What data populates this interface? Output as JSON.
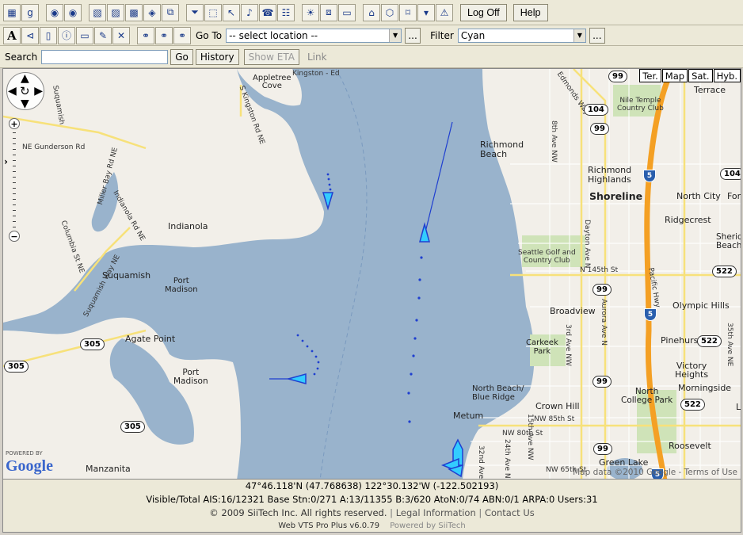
{
  "toolbar_top": {
    "logoff_label": "Log Off",
    "help_label": "Help"
  },
  "toolbar_mid": {
    "goto_label": "Go To",
    "location_value": "-- select location --",
    "filter_label": "Filter",
    "filter_value": "Cyan",
    "more_label": "..."
  },
  "toolbar_search": {
    "search_label": "Search",
    "search_value": "",
    "go_label": "Go",
    "history_label": "History",
    "show_eta_label": "Show ETA",
    "link_label": "Link"
  },
  "map": {
    "map_types": [
      "Ter.",
      "Map",
      "Sat.",
      "Hyb."
    ],
    "places": {
      "appletree_cove": "Appletree\nCove",
      "kingston": "Kingston - Ed",
      "richmond_beach": "Richmond\nBeach",
      "richmond_highlands": "Richmond\nHighlands",
      "shoreline": "Shoreline",
      "north_city": "North City",
      "ridgecrest": "Ridgecrest",
      "terrace": "Terrace",
      "nile_temple": "Nile Temple\nCountry Club",
      "indianola": "Indianola",
      "suquamish": "Suquamish",
      "port_madison_1": "Port\nMadison",
      "agate_point": "Agate Point",
      "port_madison_2": "Port\nMadison",
      "manzanita": "Manzanita",
      "seattle_golf": "Seattle Golf and\nCountry Club",
      "broadview": "Broadview",
      "carkeek": "Carkeek\nPark",
      "olympic_hills": "Olympic Hills",
      "pinehurst": "Pinehurst",
      "victory_heights": "Victory\nHeights",
      "morningside": "Morningside",
      "north_beach": "North Beach/\nBlue Ridge",
      "crown_hill": "Crown Hill",
      "north_college_park": "North\nCollege Park",
      "metum": "Metum",
      "nw_80th": "NW 80th St",
      "nw_85th": "NW 85th St",
      "nw_65th": "NW 65th St",
      "roosevelt": "Roosevelt",
      "green_lake": "Green Lake",
      "sheridan": "Sherid\nBeach",
      "ne_gunderson": "NE Gunderson Rd",
      "indianola_rd": "Indianola Rd NE",
      "miller_bay": "Miller Bay Rd NE",
      "suquamish_way": "Suquamish Way NE",
      "columbia_st": "Columbia St NE",
      "s_kingston": "S Kingston Rd NE",
      "suquamish_nw": "Suquamish",
      "pacific_hwy": "Pacific Hwy",
      "edmonds_way": "Edmonds Way",
      "aurora": "Aurora Ave N",
      "dayton": "Dayton Ave N",
      "ave_8th": "8th Ave NW",
      "ave_3rd": "3rd Ave NW",
      "n_145th": "N 145th St",
      "ave_15th": "15th Ave NW",
      "ave_24th": "24th Ave NW",
      "ave_32nd": "32nd Ave NW",
      "ave_35th": "35th Ave NE",
      "forest": "Fore",
      "lake_forest": "L"
    },
    "shields": {
      "r99a": "99",
      "r104a": "104",
      "r99b": "99",
      "r104b": "104",
      "r99c": "99",
      "r522a": "522",
      "r522b": "522",
      "r522c": "522",
      "r99d": "99",
      "r99e": "99",
      "r305a": "305",
      "r305b": "305",
      "r305c": "305"
    },
    "interstate": "5",
    "powered_by": "POWERED BY",
    "google": "Google",
    "map_data": "Map data ©2010 Google - Terms of Use"
  },
  "status": {
    "coords": "47°46.118'N (47.768638)   122°30.132'W (-122.502193)",
    "counts": "Visible/Total AIS:16/12321  Base Stn:0/271  A:13/11355  B:3/620  AtoN:0/74  ABN:0/1  ARPA:0  Users:31",
    "copyright": "© 2009 SiiTech Inc. All rights reserved.",
    "legal": "Legal Information",
    "contact": "Contact Us",
    "version": "Web VTS Pro Plus v6.0.79",
    "powered": "Powered by SiiTech"
  },
  "colors": {
    "water": "#99b3cc",
    "land": "#f2efe9",
    "vessel": "#1f3fd0",
    "vessel_fill": "#33ccff",
    "highway": "#f4a024"
  }
}
